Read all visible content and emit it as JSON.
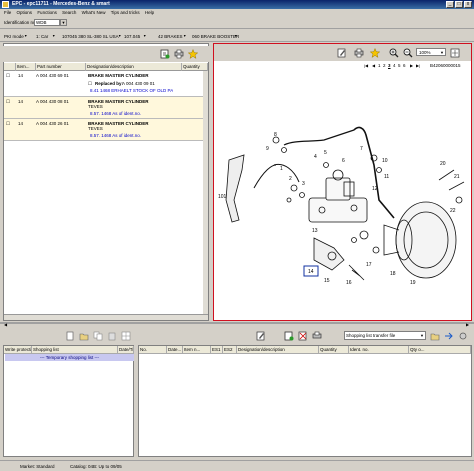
{
  "window": {
    "title": "EPC - epc11711 - Mercedes-Benz & smart",
    "minimize": "_",
    "maximize": "□",
    "close": "x"
  },
  "menu": [
    "File",
    "Options",
    "Functions",
    "Search",
    "What's New",
    "Tips and tricks",
    "Help"
  ],
  "identification": {
    "label": "Identification number",
    "value": "WDB"
  },
  "breadcrumbs": [
    "PKI mode",
    "1: Car",
    "107045 380 SL-380 SL USA",
    "107.045",
    "42 BRAKES",
    "060 BRAKE BOOSTER"
  ],
  "parts_table": {
    "headers": [
      "",
      "Item...",
      "Part number",
      "Designation/description",
      "Quantity"
    ],
    "rows": [
      {
        "item": "14",
        "part_number": "A 004 430 69 01",
        "designation": "BRAKE MASTER CYLINDER",
        "replaced_by_label": "Replaced by:",
        "replaced_by": "A 004 430 09 01",
        "note": "8.41 1468 ERHAELT STOCK OF OLD PA"
      },
      {
        "item": "14",
        "part_number": "A 004 430 08 01",
        "designation": "BRAKE MASTER CYLINDER",
        "sub": "TEVES",
        "note": "8.57. 1468 As of ident.no."
      },
      {
        "item": "14",
        "part_number": "A 004 430 26 01",
        "designation": "BRAKE MASTER CYLINDER",
        "sub": "TEVES",
        "note": "8.57. 1468 As of ident.no."
      }
    ]
  },
  "image_viewer": {
    "zoom": "100%",
    "pages": [
      "1",
      "2",
      "3",
      "4",
      "5",
      "6"
    ],
    "current_page": "3",
    "image_id": "B42060000015",
    "callouts": [
      "101",
      "14",
      "8",
      "9",
      "1",
      "2",
      "3",
      "4",
      "5",
      "6",
      "7",
      "10",
      "11",
      "12",
      "13",
      "15",
      "16",
      "17",
      "18",
      "19",
      "20",
      "21",
      "22"
    ]
  },
  "shopping_list": {
    "headers": [
      "Write protection",
      "Shopping list",
      "Date/Time"
    ],
    "row": "--- Temporary shopping list ---"
  },
  "transfer": {
    "select": "Shopping list transfer file",
    "headers": [
      "No.",
      "Date...",
      "Item n...",
      "ES1",
      "ES2",
      "Designation/description",
      "Quantity",
      "Ident. no.",
      "Qty o..."
    ]
  },
  "status": {
    "market": "Market: Standard",
    "catalog": "Catalog: 04B: Up to 09/05"
  },
  "colors": {
    "accent_red": "#d01020",
    "link_blue": "#0000cc",
    "row_highlight": "#fff8dc"
  }
}
